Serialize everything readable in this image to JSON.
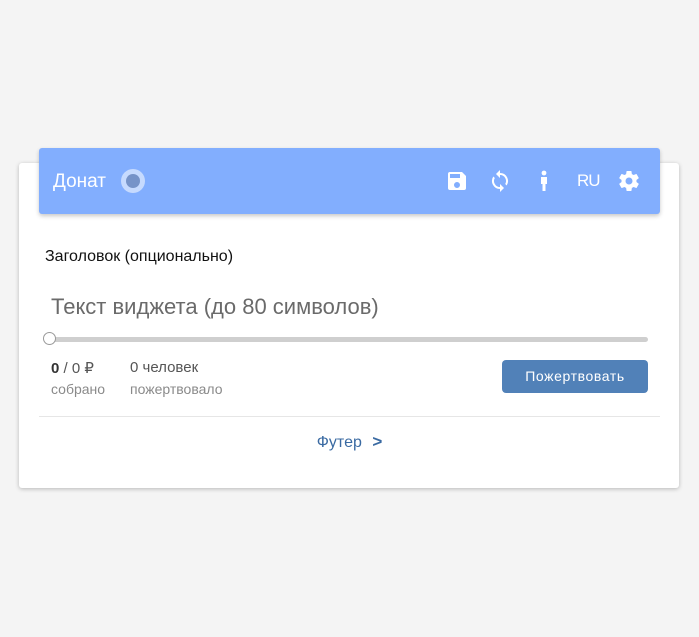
{
  "toolbar": {
    "title": "Донат",
    "lang_label": "RU",
    "icons": [
      "status-dot",
      "save-icon",
      "refresh-icon",
      "info-icon",
      "gear-icon"
    ],
    "accent_color": "#82aefe"
  },
  "widget": {
    "heading": "Заголовок (опционально)",
    "text": "Текст виджета (до 80 символов)",
    "progress": 0,
    "amount_collected": "0",
    "amount_goal": "0",
    "currency": "₽",
    "collected_label": "собрано",
    "donors_count": "0 человек",
    "donors_label": "пожертвовало",
    "donate_button": "Пожертвовать",
    "button_color": "#5181b8"
  },
  "footer": {
    "label": "Футер",
    "chevron": ">"
  }
}
